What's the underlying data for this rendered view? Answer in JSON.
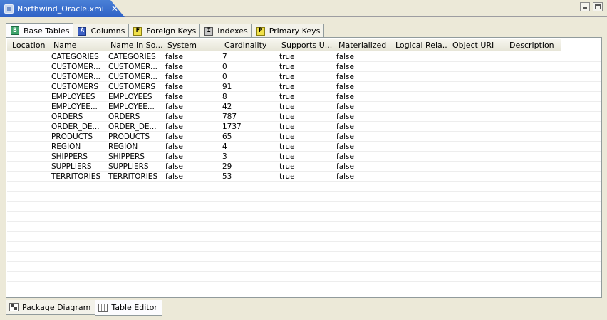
{
  "editor": {
    "tab_title": "Northwind_Oracle.xmi",
    "close_glyph": "✕"
  },
  "inner_tabs": [
    {
      "label": "Base Tables",
      "icon": "base-table-icon",
      "glyph": "B",
      "active": true
    },
    {
      "label": "Columns",
      "icon": "columns-icon",
      "glyph": "A",
      "active": false
    },
    {
      "label": "Foreign Keys",
      "icon": "foreign-key-icon",
      "glyph": "F",
      "active": false
    },
    {
      "label": "Indexes",
      "icon": "index-icon",
      "glyph": "I",
      "active": false
    },
    {
      "label": "Primary Keys",
      "icon": "primary-key-icon",
      "glyph": "P",
      "active": false
    }
  ],
  "table": {
    "columns": [
      "Location",
      "Name",
      "Name In So...",
      "System",
      "Cardinality",
      "Supports U...",
      "Materialized",
      "Logical Rela...",
      "Object URI",
      "Description"
    ],
    "rows": [
      [
        "",
        "CATEGORIES",
        "CATEGORIES",
        "false",
        "7",
        "true",
        "false",
        "",
        "",
        ""
      ],
      [
        "",
        "CUSTOMER...",
        "CUSTOMER...",
        "false",
        "0",
        "true",
        "false",
        "",
        "",
        ""
      ],
      [
        "",
        "CUSTOMER...",
        "CUSTOMER...",
        "false",
        "0",
        "true",
        "false",
        "",
        "",
        ""
      ],
      [
        "",
        "CUSTOMERS",
        "CUSTOMERS",
        "false",
        "91",
        "true",
        "false",
        "",
        "",
        ""
      ],
      [
        "",
        "EMPLOYEES",
        "EMPLOYEES",
        "false",
        "8",
        "true",
        "false",
        "",
        "",
        ""
      ],
      [
        "",
        "EMPLOYEE...",
        "EMPLOYEE...",
        "false",
        "42",
        "true",
        "false",
        "",
        "",
        ""
      ],
      [
        "",
        "ORDERS",
        "ORDERS",
        "false",
        "787",
        "true",
        "false",
        "",
        "",
        ""
      ],
      [
        "",
        "ORDER_DE...",
        "ORDER_DE...",
        "false",
        "1737",
        "true",
        "false",
        "",
        "",
        ""
      ],
      [
        "",
        "PRODUCTS",
        "PRODUCTS",
        "false",
        "65",
        "true",
        "false",
        "",
        "",
        ""
      ],
      [
        "",
        "REGION",
        "REGION",
        "false",
        "4",
        "true",
        "false",
        "",
        "",
        ""
      ],
      [
        "",
        "SHIPPERS",
        "SHIPPERS",
        "false",
        "3",
        "true",
        "false",
        "",
        "",
        ""
      ],
      [
        "",
        "SUPPLIERS",
        "SUPPLIERS",
        "false",
        "29",
        "true",
        "false",
        "",
        "",
        ""
      ],
      [
        "",
        "TERRITORIES",
        "TERRITORIES",
        "false",
        "53",
        "true",
        "false",
        "",
        "",
        ""
      ]
    ],
    "empty_rows": 12
  },
  "bottom_tabs": [
    {
      "label": "Package Diagram",
      "icon": "package-diagram-icon",
      "active": false
    },
    {
      "label": "Table Editor",
      "icon": "table-editor-icon",
      "active": true
    }
  ],
  "colors": {
    "title_active": "#2f62c6",
    "chrome": "#ece9d8"
  }
}
